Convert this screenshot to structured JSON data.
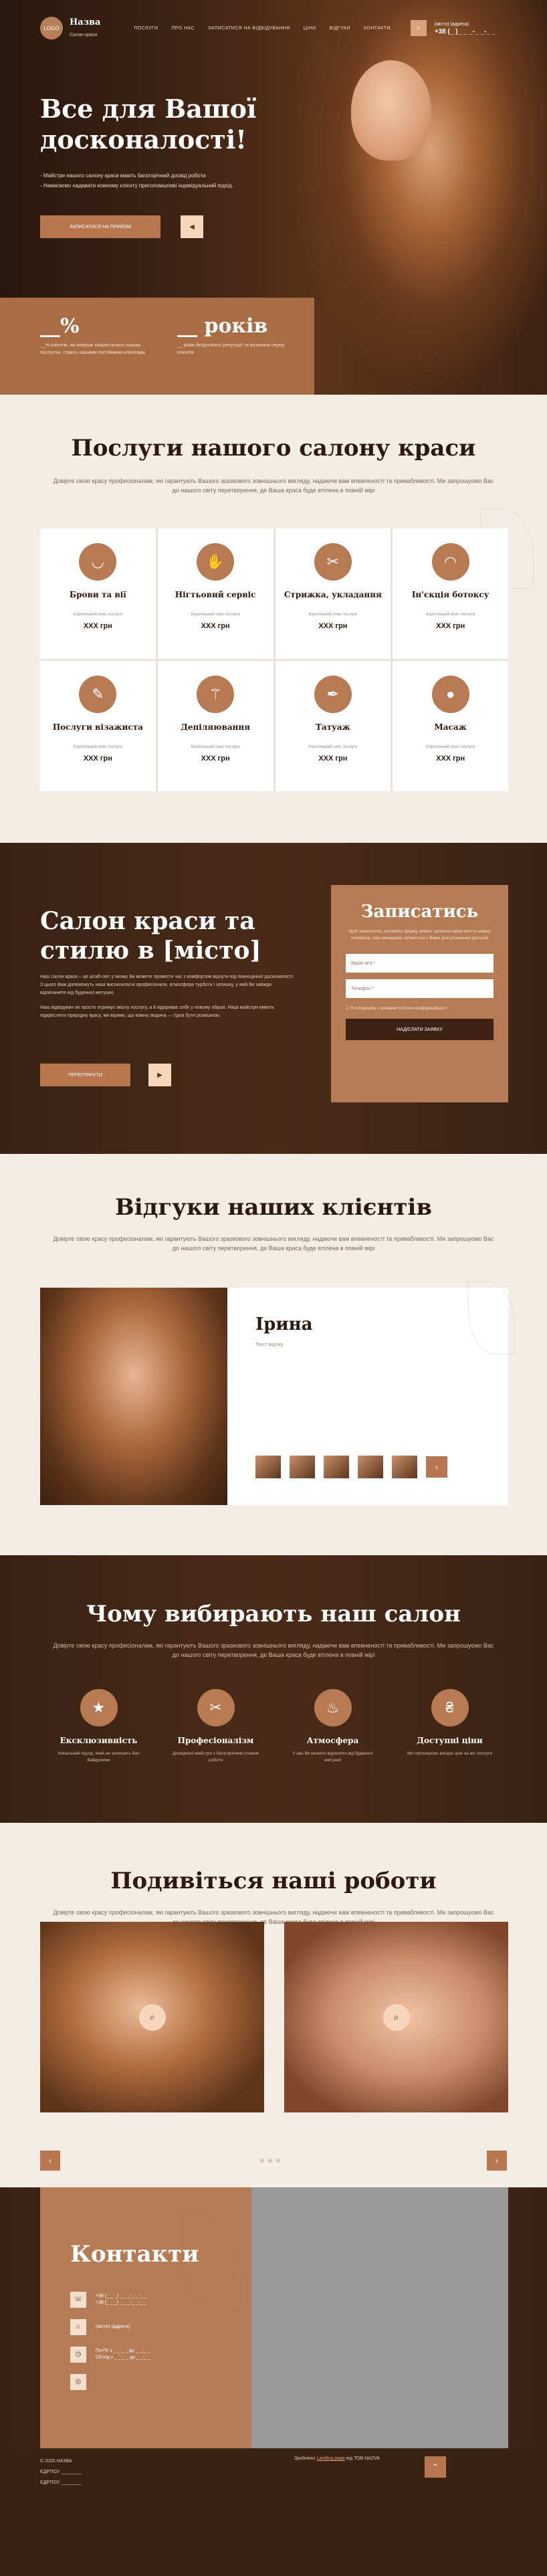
{
  "header": {
    "logo": "LOGO",
    "brand_name": "Назва",
    "brand_tagline": "Салон краси",
    "nav": [
      "ПОСЛУГИ",
      "ПРО НАС",
      "ЗАПИСАТИСЯ НА ВІДВІДУВАННЯ",
      "ЦІНИ",
      "ВІДГУКИ",
      "КОНТАКТИ"
    ],
    "phone_label": "(місто) (адреса)",
    "phone": "+38 (_ )_ _ _-_ _-_ _"
  },
  "hero": {
    "title": "Все для Вашої досконалості!",
    "points": [
      "- Майстри нашого салону краси мають багаторічний досвід роботи.",
      "- Намагаємо надавати кожному клієнту приголомшливі індивідуальний підхід."
    ],
    "cta": "ЗАПИСАТИСЯ НА ПРИЙОМ",
    "stat1_value": "__%",
    "stat1_text": "__% клієнтів, які вперше скористалися нашою послугою, стають нашими постійними клієнтами",
    "stat2_value": "__ років",
    "stat2_text": "__ років бездоганної репутації та визнання серед клієнтів"
  },
  "services": {
    "title": "Послуги нашого салону краси",
    "lead": "Довірте свою красу професіоналам, які гарантують Вашого зразкового зовнішнього вигляду, надаючи вам впевненості та привабливості. Ми запрошуємо Вас до нашого світу перетворення, де Ваша краса буде втілена в повній мірі",
    "items": [
      {
        "name": "Брови та вії",
        "icon": "brow-icon",
        "desc": "Коротенький опис послуги",
        "price": "XXX грн"
      },
      {
        "name": "Нігтьовий сервіс",
        "icon": "nail-icon",
        "desc": "Коротенький опис послуги",
        "price": "XXX грн"
      },
      {
        "name": "Стрижка, укладання",
        "icon": "scissors-icon",
        "desc": "Коротенький опис послуги",
        "price": "XXX грн"
      },
      {
        "name": "Ін'єкція ботоксу",
        "icon": "lips-icon",
        "desc": "Коротенький опис послуги",
        "price": "XXX грн"
      },
      {
        "name": "Послуги візажиста",
        "icon": "makeup-icon",
        "desc": "Коротенький опис послуги",
        "price": "XXX грн"
      },
      {
        "name": "Депіляювання",
        "icon": "razor-icon",
        "desc": "Коротенький опис послуги",
        "price": "XXX грн"
      },
      {
        "name": "Татуаж",
        "icon": "tattoo-icon",
        "desc": "Коротенький опис послуги",
        "price": "XXX грн"
      },
      {
        "name": "Масаж",
        "icon": "massage-icon",
        "desc": "Коротенький опис послуги",
        "price": "XXX грн"
      }
    ]
  },
  "salon": {
    "title": "Салон краси та стилю в [місто]",
    "text1": "Наш салон краси – це штаб-світ у якому Ви можете провести час з комфортом відчути від повноцінної досконалості. З цього Вам допоможуть наші висококласні професіонали, атмосфера турботи і затишку, у якій Ви завжди відпочинете від буденної метушні.",
    "text2": "Наш відвідувач не просто отримує якісну послугу, а й відкриває себе у новому образі. Наші майстри вміють підкреслити природну красу, ми віримо, що кожна людина — гідна бути розкішною.",
    "cta": "ПЕРЕГЛЯНУТИ",
    "form_title": "Записатись",
    "form_text": "Щоб записатися, заповніть форму нижче, залиште ваше ім'я та номер телефону, наш менеджер зв'яжеться з Вами для уточнення деталей",
    "name_placeholder": "Ваше ім'я *",
    "phone_placeholder": "Телефон *",
    "agree": "Я погоджуюсь з умовами політики конфіденційності",
    "submit": "НАДІСЛАТИ ЗАЯВКУ"
  },
  "reviews": {
    "title": "Відгуки наших клієнтів",
    "lead": "Довірте свою красу професіоналам, які гарантують Вашого зразкового зовнішнього вигляду, надаючи вам впевненості та привабливості. Ми запрошуємо Вас до нашого світу перетворення, де Ваша краса буде втілена в повній мірі",
    "name": "Ірина",
    "text": "Текст відгуку"
  },
  "why": {
    "title": "Чому вибирають наш салон",
    "lead": "Довірте свою красу професіоналам, які гарантують Вашого зразкового зовнішнього вигляду, надаючи вам впевненості та привабливості. Ми запрошуємо Вас до нашого світу перетворення, де Ваша краса буде втілена в повній мірі",
    "items": [
      {
        "title": "Ексклюзивність",
        "icon": "star-icon",
        "text": "Унікальний підхід, який не залишить Вас байдужими"
      },
      {
        "title": "Професіоналізм",
        "icon": "tools-icon",
        "text": "Досвідчені майстри з багаторічним стажем роботи"
      },
      {
        "title": "Атмосфера",
        "icon": "comfort-icon",
        "text": "У нас Ви можете відпочити від буденної метушні"
      },
      {
        "title": "Доступні ціни",
        "icon": "price-icon",
        "text": "Ми пропонуємо вигідні ціни на всі послуги"
      }
    ]
  },
  "works": {
    "title": "Подивіться наші роботи",
    "lead": "Довірте свою красу професіоналам, які гарантують Вашого зразкового зовнішнього вигляду, надаючи вам впевненості та привабливості. Ми запрошуємо Вас до нашого світу перетворення, де Ваша краса буде втілена в повній мірі"
  },
  "contacts": {
    "title": "Контакти",
    "phone1": "+38 (_ _ _) _ _ _-_ _-_ _",
    "phone2": "+38 (_ _ _) _ _ _-_ _-_ _",
    "address": "(місто) (адреса)",
    "hours1": "Пн-Пт з _ _:_ _ до _ _:_ _",
    "hours2": "Сб-Нд з _ _:_ _ до _ _:_ _"
  },
  "footer": {
    "copy": "© 2020 НАЗВА",
    "edrpou1": "ЄДРПОУ ________",
    "edrpou2": "ЄДРПОУ ________",
    "dev_prefix": "Зроблено",
    "dev_link": "Landing page",
    "dev_suffix": "від ТОВ NAZVA"
  },
  "colors": {
    "accent": "#b9774f",
    "dark": "#3a2213",
    "light": "#f4ede6",
    "peach": "#f6d6bd"
  }
}
